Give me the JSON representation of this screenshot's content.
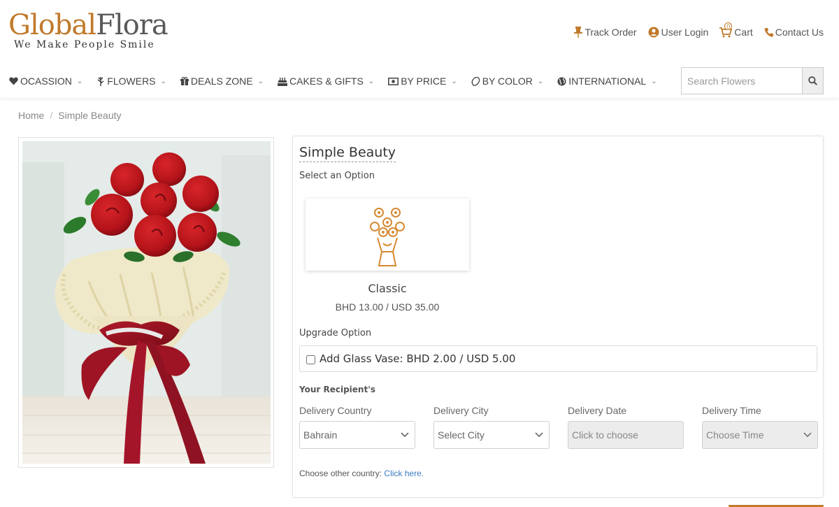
{
  "brand": {
    "name_part1": "Global",
    "name_part2": "Flora",
    "tagline": "We Make People Smile",
    "accent_color": "#c07a2c"
  },
  "top_links": {
    "track_order": "Track Order",
    "user_login": "User Login",
    "cart": "Cart",
    "cart_count": "0",
    "contact_us": "Contact Us"
  },
  "nav": {
    "items": [
      {
        "label": "OCASSION",
        "icon": "heart-icon"
      },
      {
        "label": "FLOWERS",
        "icon": "flower-icon"
      },
      {
        "label": "DEALS ZONE",
        "icon": "gift-icon"
      },
      {
        "label": "CAKES & GIFTS",
        "icon": "cake-icon"
      },
      {
        "label": "BY PRICE",
        "icon": "money-icon"
      },
      {
        "label": "BY COLOR",
        "icon": "color-icon"
      },
      {
        "label": "INTERNATIONAL",
        "icon": "globe-icon"
      }
    ],
    "search_placeholder": "Search Flowers"
  },
  "breadcrumb": {
    "home": "Home",
    "separator": "/",
    "current": "Simple Beauty"
  },
  "product": {
    "title": "Simple Beauty",
    "select_option_label": "Select an Option",
    "option": {
      "name": "Classic",
      "price": "BHD 13.00 / USD 35.00",
      "icon": "bouquet-icon"
    },
    "upgrade_label": "Upgrade Option",
    "upgrade_text": "Add Glass Vase: BHD 2.00 / USD 5.00",
    "recipient_label": "Your Recipient's",
    "fields": {
      "country_label": "Delivery Country",
      "country_value": "Bahrain",
      "city_label": "Delivery City",
      "city_value": "Select City",
      "date_label": "Delivery Date",
      "date_value": "Click to choose",
      "time_label": "Delivery Time",
      "time_value": "Choose Time"
    },
    "other_country_text": "Choose other country: ",
    "other_country_link": "Click here."
  }
}
